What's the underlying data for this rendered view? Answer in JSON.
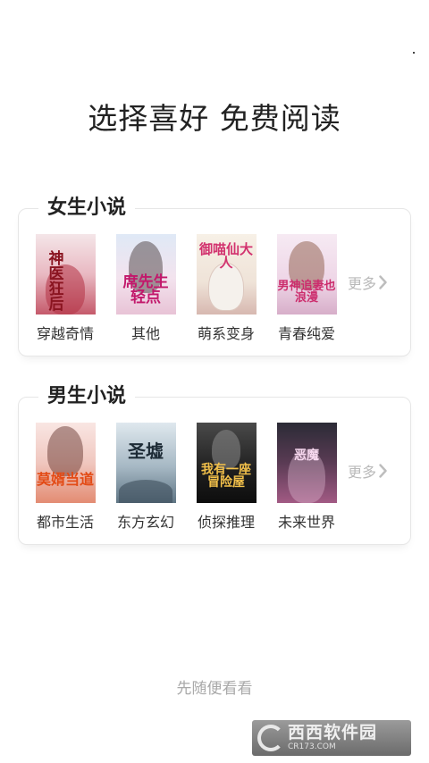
{
  "headline": "选择喜好 免费阅读",
  "female": {
    "title": "女生小说",
    "more_label": "更多",
    "genres": [
      {
        "label": "穿越奇情",
        "cover_text": "神医狂后"
      },
      {
        "label": "其他",
        "cover_text": "席先生轻点"
      },
      {
        "label": "萌系变身",
        "cover_text": "御喵仙大人"
      },
      {
        "label": "青春纯爱",
        "cover_text": "男神追妻也浪漫"
      }
    ]
  },
  "male": {
    "title": "男生小说",
    "more_label": "更多",
    "genres": [
      {
        "label": "都市生活",
        "cover_text": "莫婿当道"
      },
      {
        "label": "东方玄幻",
        "cover_text": "圣墟"
      },
      {
        "label": "侦探推理",
        "cover_text": "我有一座冒险屋"
      },
      {
        "label": "未来世界",
        "cover_text": "恶魔"
      }
    ]
  },
  "skip_label": "先随便看看",
  "watermark": {
    "text": "西西软件园",
    "sub": "CR173.COM"
  }
}
